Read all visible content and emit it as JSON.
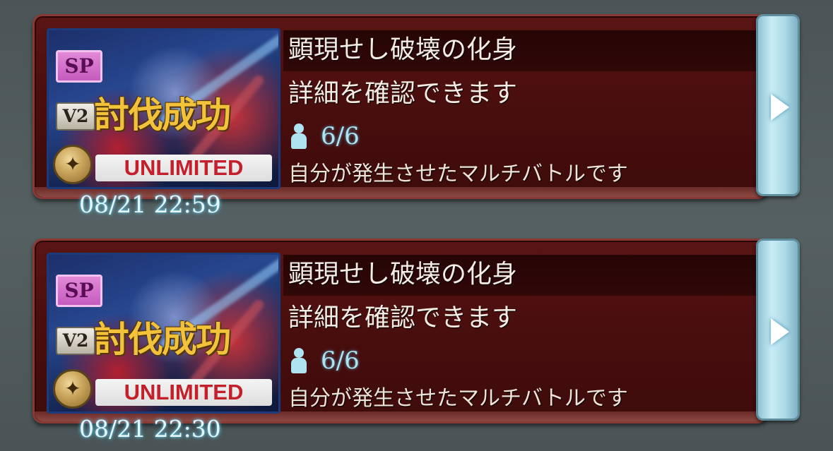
{
  "cards": [
    {
      "badge_sp": "SP",
      "badge_v2": "V2",
      "status_label": "討伐成功",
      "unlimited_label": "UNLIMITED",
      "title": "顕現せし破壊の化身",
      "detail": "詳細を確認できます",
      "players": "6/6",
      "description": "自分が発生させたマルチバトルです",
      "timestamp": "08/21  22:59"
    },
    {
      "badge_sp": "SP",
      "badge_v2": "V2",
      "status_label": "討伐成功",
      "unlimited_label": "UNLIMITED",
      "title": "顕現せし破壊の化身",
      "detail": "詳細を確認できます",
      "players": "6/6",
      "description": "自分が発生させたマルチバトルです",
      "timestamp": "08/21  22:30"
    }
  ],
  "icons": {
    "player": "person-icon",
    "arrow": "play-arrow-icon",
    "medal": "medal-icon"
  },
  "colors": {
    "panel": "#4a0e0e",
    "accent": "#aee3f0",
    "status_gold": "#f1c23a",
    "unlimited_red": "#c3202b"
  }
}
